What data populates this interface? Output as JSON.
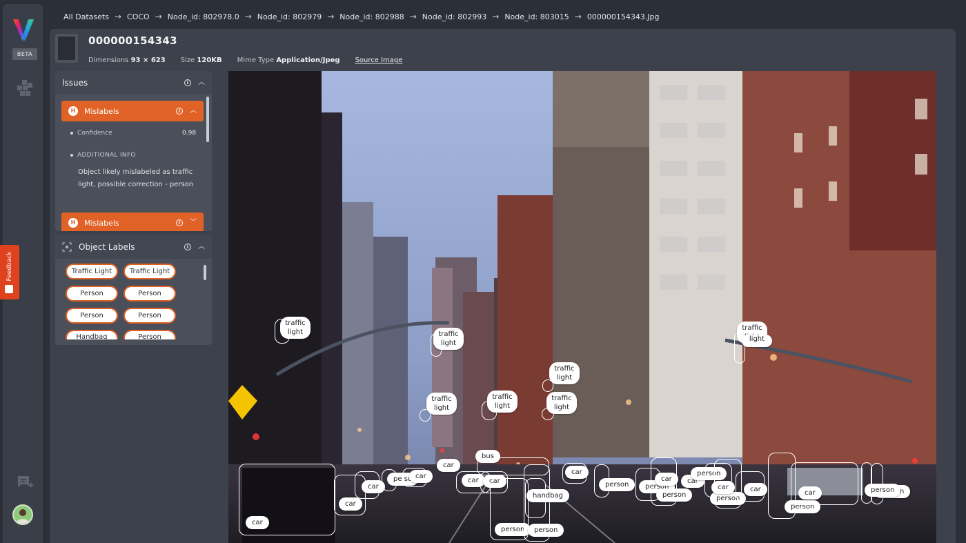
{
  "app": {
    "beta_label": "BETA",
    "feedback_label": "Feedback"
  },
  "breadcrumb": [
    "All Datasets",
    "COCO",
    "Node_id: 802978.0",
    "Node_id: 802979",
    "Node_id: 802988",
    "Node_id: 802993",
    "Node_id: 803015",
    "000000154343.Jpg"
  ],
  "file": {
    "title": "000000154343",
    "dimensions_label": "Dimensions",
    "dimensions_value": "93 × 623",
    "size_label": "Size",
    "size_value": "120KB",
    "mime_label": "Mime Type",
    "mime_value": "Application/Jpeg",
    "source_link": "Source Image"
  },
  "issues": {
    "title": "Issues",
    "items": [
      {
        "badge": "H",
        "label": "Mislabels",
        "confidence_label": "Confidence",
        "confidence_value": "0.98",
        "additional_label": "ADDITIONAL INFO",
        "description": "Object likely mislabeled as traffic light, possible correction - person"
      },
      {
        "badge": "H",
        "label": "Mislabels"
      }
    ]
  },
  "object_labels": {
    "title": "Object Labels",
    "chips": [
      "Traffic Light",
      "Traffic Light",
      "Person",
      "Person",
      "Person",
      "Person",
      "Handbag",
      "Person"
    ]
  },
  "annotations": {
    "traffic_light_label": "traffic light",
    "car": "car",
    "bus": "bus",
    "person": "person",
    "handbag": "handbag",
    "person_partial": "pe so"
  },
  "colors": {
    "accent": "#e06227",
    "feedback": "#e0421f",
    "panel": "#3d414b",
    "background": "#2b2f38"
  }
}
